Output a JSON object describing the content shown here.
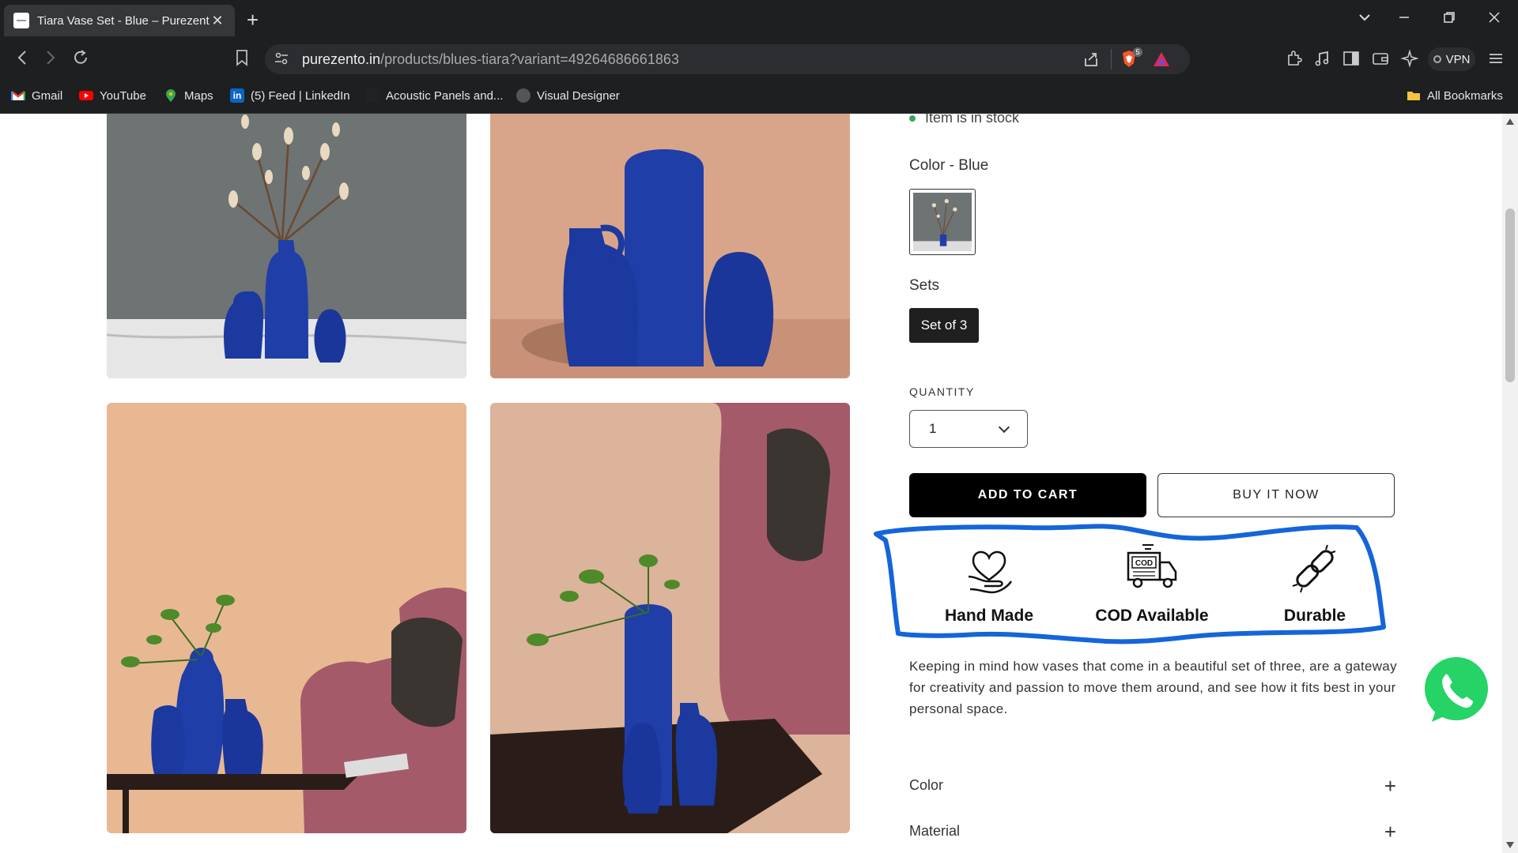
{
  "browser": {
    "tab_title": "Tiara Vase Set - Blue – Purezento",
    "url_host": "purezento.in",
    "url_path": "/products/blues-tiara?variant=49264686661863",
    "vpn_label": "VPN",
    "brave_badge": "5",
    "bookmarks": [
      {
        "label": "Gmail",
        "icon": "gmail-icon"
      },
      {
        "label": "YouTube",
        "icon": "youtube-icon"
      },
      {
        "label": "Maps",
        "icon": "maps-icon"
      },
      {
        "label": "(5) Feed | LinkedIn",
        "icon": "linkedin-icon"
      },
      {
        "label": "Acoustic Panels and...",
        "icon": "page-icon"
      },
      {
        "label": "Visual Designer",
        "icon": "designer-icon"
      }
    ],
    "all_bookmarks": "All Bookmarks"
  },
  "product": {
    "stock_text": "Item is in stock",
    "color_label": "Color - Blue",
    "sets_label": "Sets",
    "set_option": "Set of 3",
    "quantity_label": "QUANTITY",
    "quantity_value": "1",
    "add_to_cart": "ADD TO CART",
    "buy_now": "BUY IT NOW",
    "features": [
      {
        "label": "Hand Made",
        "icon": "heart-hand-icon"
      },
      {
        "label": "COD Available",
        "icon": "cod-truck-icon"
      },
      {
        "label": "Durable",
        "icon": "chain-link-icon"
      }
    ],
    "cod_badge": "COD",
    "description": "Keeping in mind how vases that come in a beautiful set of three, are a gateway for creativity and passion to move them around, and see how it fits best in your personal space.",
    "accordions": [
      "Color",
      "Material"
    ]
  },
  "colors": {
    "vase_blue": "#1f3ea8",
    "annotation_blue": "#1565d8"
  }
}
